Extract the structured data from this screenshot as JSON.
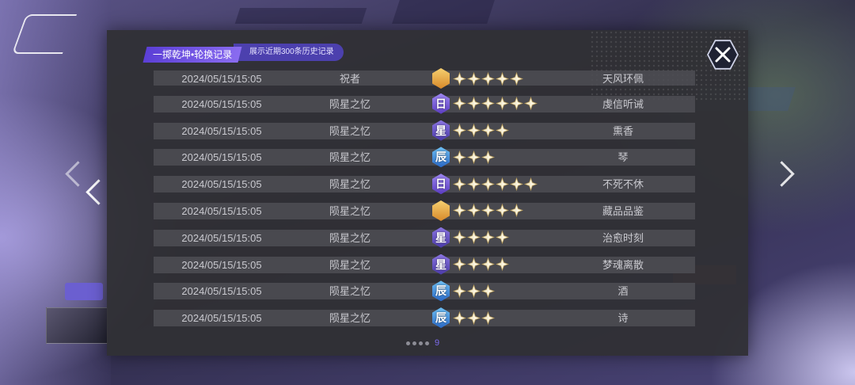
{
  "modal": {
    "title": "一掷乾坤•轮换记录",
    "subtitle": "展示近期300条历史记录"
  },
  "colors": {
    "accent": "#6b55e0",
    "gold_badge": "#e6a43a",
    "purple_badge": "#7a5ad8",
    "violet_badge": "#6b52c8",
    "blue_badge": "#3a86d8",
    "star": "#f2e9c8"
  },
  "rows": [
    {
      "date": "2024/05/15/15:05",
      "type": "祝者",
      "badge": "gold",
      "badge_char": "",
      "stars": 5,
      "name": "天风环佩"
    },
    {
      "date": "2024/05/15/15:05",
      "type": "陨星之忆",
      "badge": "purple",
      "badge_char": "日",
      "stars": 6,
      "name": "虔信听诫"
    },
    {
      "date": "2024/05/15/15:05",
      "type": "陨星之忆",
      "badge": "violet",
      "badge_char": "星",
      "stars": 4,
      "name": "熏香"
    },
    {
      "date": "2024/05/15/15:05",
      "type": "陨星之忆",
      "badge": "blue",
      "badge_char": "辰",
      "stars": 3,
      "name": "琴"
    },
    {
      "date": "2024/05/15/15:05",
      "type": "陨星之忆",
      "badge": "purple",
      "badge_char": "日",
      "stars": 6,
      "name": "不死不休"
    },
    {
      "date": "2024/05/15/15:05",
      "type": "陨星之忆",
      "badge": "gold",
      "badge_char": "",
      "stars": 5,
      "name": "藏品品鉴"
    },
    {
      "date": "2024/05/15/15:05",
      "type": "陨星之忆",
      "badge": "violet",
      "badge_char": "星",
      "stars": 4,
      "name": "治愈时刻"
    },
    {
      "date": "2024/05/15/15:05",
      "type": "陨星之忆",
      "badge": "violet",
      "badge_char": "星",
      "stars": 4,
      "name": "梦魂离散"
    },
    {
      "date": "2024/05/15/15:05",
      "type": "陨星之忆",
      "badge": "blue",
      "badge_char": "辰",
      "stars": 3,
      "name": "酒"
    },
    {
      "date": "2024/05/15/15:05",
      "type": "陨星之忆",
      "badge": "blue",
      "badge_char": "辰",
      "stars": 3,
      "name": "诗"
    }
  ],
  "pager": {
    "dot_count": 4,
    "current_page": "9"
  },
  "icons": {
    "close": "close-icon",
    "prev": "chevron-left-icon",
    "next": "chevron-right-icon"
  }
}
